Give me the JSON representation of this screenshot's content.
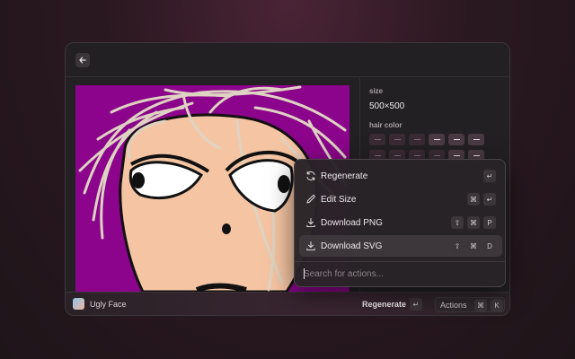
{
  "app": {
    "name": "Ugly Face"
  },
  "side": {
    "size_label": "size",
    "size_value": "500×500",
    "hair_label": "hair color"
  },
  "status": {
    "primary_action": "Regenerate",
    "primary_key": "↵",
    "actions_label": "Actions",
    "actions_keys": [
      "⌘",
      "K"
    ]
  },
  "menu": {
    "items": [
      {
        "label": "Regenerate",
        "icon": "refresh-icon",
        "keys": [
          "↵"
        ]
      },
      {
        "label": "Edit Size",
        "icon": "pencil-icon",
        "keys": [
          "⌘",
          "↵"
        ]
      },
      {
        "label": "Download PNG",
        "icon": "download-icon",
        "keys": [
          "⇧",
          "⌘",
          "P"
        ]
      },
      {
        "label": "Download SVG",
        "icon": "download-icon",
        "keys": [
          "⇧",
          "⌘",
          "D"
        ]
      }
    ],
    "search_placeholder": "Search for actions..."
  },
  "colors": {
    "background": "#8b048b",
    "skin": "#f5c4a3",
    "hair": "#ded3c2"
  }
}
